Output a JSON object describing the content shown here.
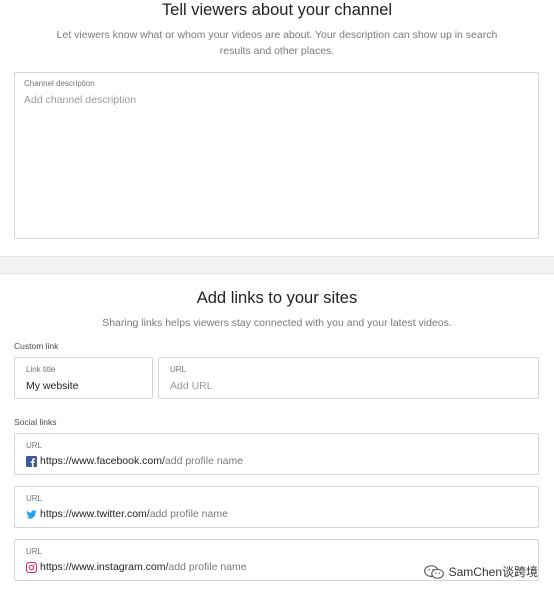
{
  "description_section": {
    "title": "Tell viewers about your channel",
    "subtitle": "Let viewers know what or whom your videos are about. Your description can show up in search results and other places.",
    "field_label": "Channel description",
    "field_placeholder": "Add channel description"
  },
  "links_section": {
    "title": "Add links to your sites",
    "subtitle": "Sharing links helps viewers stay connected with you and your latest videos.",
    "custom_link_heading": "Custom link",
    "link_title_label": "Link title",
    "link_title_value": "My website",
    "url_label": "URL",
    "url_placeholder": "Add URL",
    "social_heading": "Social links",
    "social_links": [
      {
        "label": "URL",
        "base": "https://www.facebook.com/",
        "suffix": "add profile name",
        "icon": "facebook-icon"
      },
      {
        "label": "URL",
        "base": "https://www.twitter.com/",
        "suffix": "add profile name",
        "icon": "twitter-icon"
      },
      {
        "label": "URL",
        "base": "https://www.instagram.com/",
        "suffix": "add profile name",
        "icon": "instagram-icon"
      }
    ]
  },
  "watermark": {
    "text": "SamChen谈跨境",
    "icon": "wechat-icon"
  },
  "colors": {
    "facebook": "#3b5998",
    "twitter": "#1da1f2",
    "instagram": "#e1306c"
  }
}
